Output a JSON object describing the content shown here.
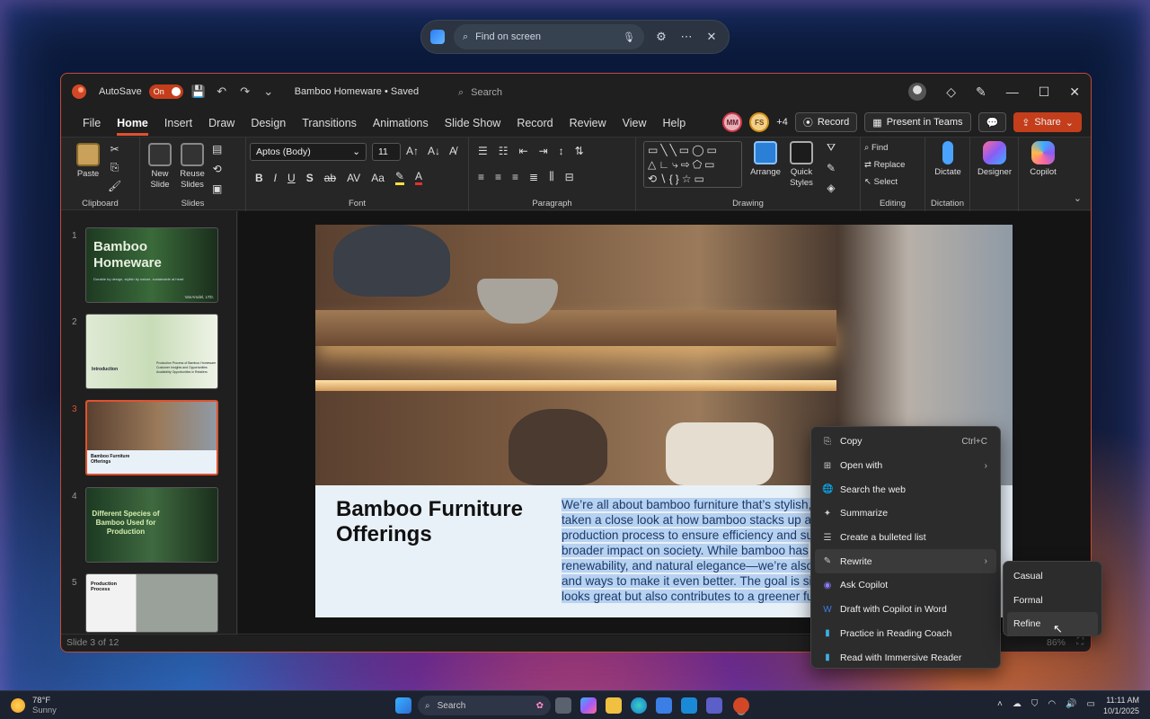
{
  "find_bar": {
    "placeholder": "Find on screen"
  },
  "window": {
    "autosave_label": "AutoSave",
    "autosave_state": "On",
    "doc_title": "Bamboo Homeware • Saved",
    "search_placeholder": "Search"
  },
  "menu": {
    "tabs": [
      "File",
      "Home",
      "Insert",
      "Draw",
      "Design",
      "Transitions",
      "Animations",
      "Slide Show",
      "Record",
      "Review",
      "View",
      "Help"
    ],
    "active": "Home",
    "collab": {
      "mm": "MM",
      "fs": "FS",
      "more": "+4"
    },
    "record_label": "Record",
    "teams_label": "Present in Teams",
    "share_label": "Share"
  },
  "ribbon": {
    "clipboard": {
      "paste": "Paste",
      "label": "Clipboard"
    },
    "slides": {
      "new_slide": "New Slide",
      "reuse": "Reuse Slides",
      "label": "Slides"
    },
    "font": {
      "family": "Aptos (Body)",
      "size": "11",
      "label": "Font"
    },
    "paragraph": {
      "label": "Paragraph"
    },
    "drawing": {
      "arrange": "Arrange",
      "quick_styles": "Quick Styles",
      "label": "Drawing"
    },
    "editing": {
      "find": "Find",
      "replace": "Replace",
      "select": "Select",
      "label": "Editing"
    },
    "dictation": {
      "dictate": "Dictate",
      "label": "Dictation"
    },
    "designer": "Designer",
    "copilot": "Copilot"
  },
  "thumbs": [
    {
      "num": "1",
      "title": "Bamboo Homeware",
      "sub": "Durable by design, stylish by nature, sustainable at heart",
      "brand": "VanArsdel, LTD."
    },
    {
      "num": "2",
      "title": "Introduction",
      "bullets": [
        "Production Process of Bamboo Homeware",
        "Customer Insights and Opportunities",
        "Availability Opportunities in Retailers"
      ]
    },
    {
      "num": "3",
      "title": "Bamboo Furniture Offerings"
    },
    {
      "num": "4",
      "title": "Different Species of Bamboo Used for Production"
    },
    {
      "num": "5",
      "title": "Production Process"
    }
  ],
  "slide": {
    "title": "Bamboo Furniture Offerings",
    "body_lines": [
      "We’re all about bamboo furniture that’s stylish,",
      "taken a close look at how bamboo stacks up ag",
      "production process to ensure efficiency and su",
      "broader impact on society. While bamboo has",
      "renewability, and natural elegance—we’re also",
      "and ways to make it even better. The goal is sim",
      "looks great but also contributes to a greener fu"
    ]
  },
  "status": {
    "slide_of": "Slide 3 of 12",
    "zoom": "86%"
  },
  "context_menu": [
    {
      "label": "Copy",
      "shortcut": "Ctrl+C",
      "icon": "copy-icon"
    },
    {
      "label": "Open with",
      "arrow": "›",
      "icon": "open-with-icon"
    },
    {
      "label": "Search the web",
      "icon": "globe-icon"
    },
    {
      "label": "Summarize",
      "icon": "summarize-icon"
    },
    {
      "label": "Create a bulleted list",
      "icon": "list-icon"
    },
    {
      "label": "Rewrite",
      "arrow": "›",
      "icon": "rewrite-icon"
    },
    {
      "label": "Ask Copilot",
      "icon": "copilot-icon"
    },
    {
      "label": "Draft with Copilot in Word",
      "icon": "word-icon"
    },
    {
      "label": "Practice in Reading Coach",
      "icon": "reading-coach-icon"
    },
    {
      "label": "Read with Immersive Reader",
      "icon": "immersive-reader-icon"
    }
  ],
  "rewrite_submenu": [
    "Casual",
    "Formal",
    "Refine"
  ],
  "taskbar": {
    "temp": "78°F",
    "weather": "Sunny",
    "search": "Search",
    "time": "11:11 AM",
    "date": "10/1/2025"
  }
}
